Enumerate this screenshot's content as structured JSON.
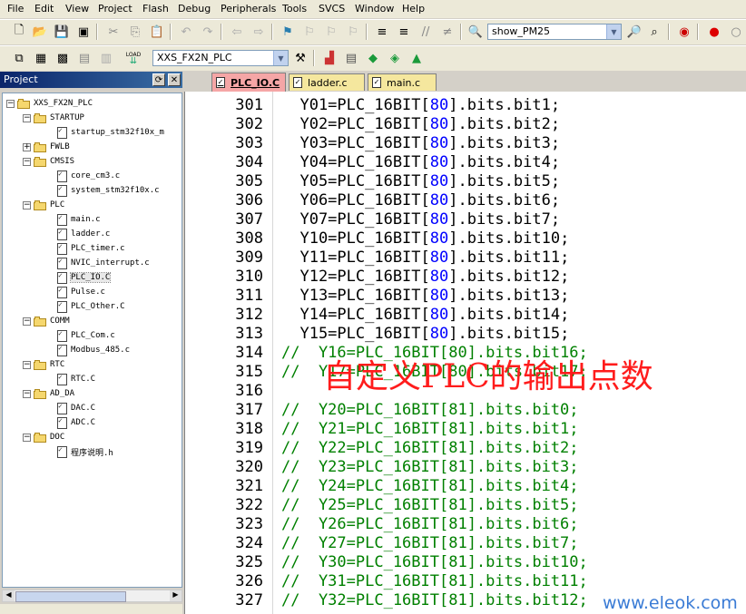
{
  "menu": [
    "File",
    "Edit",
    "View",
    "Project",
    "Flash",
    "Debug",
    "Peripherals",
    "Tools",
    "SVCS",
    "Window",
    "Help"
  ],
  "toolbar": {
    "find_combo_value": "show_PM25",
    "target_combo_value": "XXS_FX2N_PLC",
    "load_label": "LOAD"
  },
  "project_panel": {
    "title": "Project",
    "root": "XXS_FX2N_PLC",
    "groups": [
      {
        "name": "STARTUP",
        "files": [
          "startup_stm32f10x_m"
        ]
      },
      {
        "name": "FWLB",
        "files": []
      },
      {
        "name": "CMSIS",
        "files": [
          "core_cm3.c",
          "system_stm32f10x.c"
        ]
      },
      {
        "name": "PLC",
        "files": [
          "main.c",
          "ladder.c",
          "PLC_timer.c",
          "NVIC_interrupt.c",
          "PLC_IO.C",
          "Pulse.c",
          "PLC_Other.C"
        ]
      },
      {
        "name": "COMM",
        "files": [
          "PLC_Com.c",
          "Modbus_485.c"
        ]
      },
      {
        "name": "RTC",
        "files": [
          "RTC.C"
        ]
      },
      {
        "name": "AD_DA",
        "files": [
          "DAC.C",
          "ADC.C"
        ]
      },
      {
        "name": "DOC",
        "files": [
          "程序说明.h"
        ]
      }
    ]
  },
  "tabs": [
    {
      "label": "PLC_IO.C",
      "active": true
    },
    {
      "label": "ladder.c",
      "active": false
    },
    {
      "label": "main.c",
      "active": false
    }
  ],
  "code_lines": [
    {
      "n": "301",
      "pre": "  Y01=PLC_16BIT[",
      "idx": "80",
      "post": "].bits.bit1;",
      "comment": false
    },
    {
      "n": "302",
      "pre": "  Y02=PLC_16BIT[",
      "idx": "80",
      "post": "].bits.bit2;",
      "comment": false
    },
    {
      "n": "303",
      "pre": "  Y03=PLC_16BIT[",
      "idx": "80",
      "post": "].bits.bit3;",
      "comment": false
    },
    {
      "n": "304",
      "pre": "  Y04=PLC_16BIT[",
      "idx": "80",
      "post": "].bits.bit4;",
      "comment": false
    },
    {
      "n": "305",
      "pre": "  Y05=PLC_16BIT[",
      "idx": "80",
      "post": "].bits.bit5;",
      "comment": false
    },
    {
      "n": "306",
      "pre": "  Y06=PLC_16BIT[",
      "idx": "80",
      "post": "].bits.bit6;",
      "comment": false
    },
    {
      "n": "307",
      "pre": "  Y07=PLC_16BIT[",
      "idx": "80",
      "post": "].bits.bit7;",
      "comment": false
    },
    {
      "n": "308",
      "pre": "  Y10=PLC_16BIT[",
      "idx": "80",
      "post": "].bits.bit10;",
      "comment": false
    },
    {
      "n": "309",
      "pre": "  Y11=PLC_16BIT[",
      "idx": "80",
      "post": "].bits.bit11;",
      "comment": false
    },
    {
      "n": "310",
      "pre": "  Y12=PLC_16BIT[",
      "idx": "80",
      "post": "].bits.bit12;",
      "comment": false
    },
    {
      "n": "311",
      "pre": "  Y13=PLC_16BIT[",
      "idx": "80",
      "post": "].bits.bit13;",
      "comment": false
    },
    {
      "n": "312",
      "pre": "  Y14=PLC_16BIT[",
      "idx": "80",
      "post": "].bits.bit14;",
      "comment": false
    },
    {
      "n": "313",
      "pre": "  Y15=PLC_16BIT[",
      "idx": "80",
      "post": "].bits.bit15;",
      "comment": false
    },
    {
      "n": "314",
      "pre": "//  Y16=PLC_16BIT[80].bits.bit16;",
      "idx": "",
      "post": "",
      "comment": true
    },
    {
      "n": "315",
      "pre": "//  Y17=PLC_16BIT[80].bits.bit17;",
      "idx": "",
      "post": "",
      "comment": true
    },
    {
      "n": "316",
      "pre": "",
      "idx": "",
      "post": "",
      "comment": false
    },
    {
      "n": "317",
      "pre": "//  Y20=PLC_16BIT[81].bits.bit0;",
      "idx": "",
      "post": "",
      "comment": true
    },
    {
      "n": "318",
      "pre": "//  Y21=PLC_16BIT[81].bits.bit1;",
      "idx": "",
      "post": "",
      "comment": true
    },
    {
      "n": "319",
      "pre": "//  Y22=PLC_16BIT[81].bits.bit2;",
      "idx": "",
      "post": "",
      "comment": true
    },
    {
      "n": "320",
      "pre": "//  Y23=PLC_16BIT[81].bits.bit3;",
      "idx": "",
      "post": "",
      "comment": true
    },
    {
      "n": "321",
      "pre": "//  Y24=PLC_16BIT[81].bits.bit4;",
      "idx": "",
      "post": "",
      "comment": true
    },
    {
      "n": "322",
      "pre": "//  Y25=PLC_16BIT[81].bits.bit5;",
      "idx": "",
      "post": "",
      "comment": true
    },
    {
      "n": "323",
      "pre": "//  Y26=PLC_16BIT[81].bits.bit6;",
      "idx": "",
      "post": "",
      "comment": true
    },
    {
      "n": "324",
      "pre": "//  Y27=PLC_16BIT[81].bits.bit7;",
      "idx": "",
      "post": "",
      "comment": true
    },
    {
      "n": "325",
      "pre": "//  Y30=PLC_16BIT[81].bits.bit10;",
      "idx": "",
      "post": "",
      "comment": true
    },
    {
      "n": "326",
      "pre": "//  Y31=PLC_16BIT[81].bits.bit11;",
      "idx": "",
      "post": "",
      "comment": true
    },
    {
      "n": "327",
      "pre": "//  Y32=PLC_16BIT[81].bits.bit12;",
      "idx": "",
      "post": "",
      "comment": true
    }
  ],
  "overlay_text": "自定义PLC的输出点数",
  "watermark": "www.eleok.com",
  "colors": {
    "comment": "#008000",
    "number": "#0000ff",
    "overlay": "#ff1c1c",
    "active_tab": "#f5a6a6",
    "tab": "#f5e79e"
  }
}
